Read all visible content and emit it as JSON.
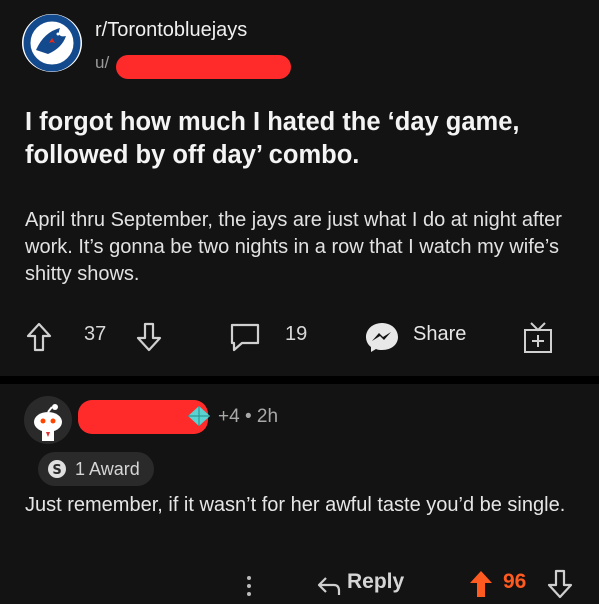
{
  "post": {
    "subreddit": "r/Torontobluejays",
    "user_prefix": "u/",
    "title": "I forgot how much I hated the ‘day game, followed by off day’ combo.",
    "body": "April thru September, the jays are just what I do at night after work. It’s gonna be two nights in a row that I watch my wife’s shitty shows.",
    "upvotes": "37",
    "comments": "19",
    "share_label": "Share",
    "icons": [
      "blue-jays-logo",
      "upvote-arrow",
      "downvote-arrow",
      "comment-bubble",
      "messenger",
      "award-gift"
    ]
  },
  "comment": {
    "award_count": "+4",
    "separator": "•",
    "age": "2h",
    "award_label": "1 Award",
    "body": "Just remember, if it wasn’t for her awful taste you’d be single.",
    "reply_label": "Reply",
    "score": "96",
    "icons": [
      "snoo-avatar",
      "diamond-award",
      "silver-award",
      "more-dots",
      "reply-arrow",
      "upvote-filled",
      "downvote-arrow"
    ],
    "accent_color": "#ff5a1f"
  }
}
